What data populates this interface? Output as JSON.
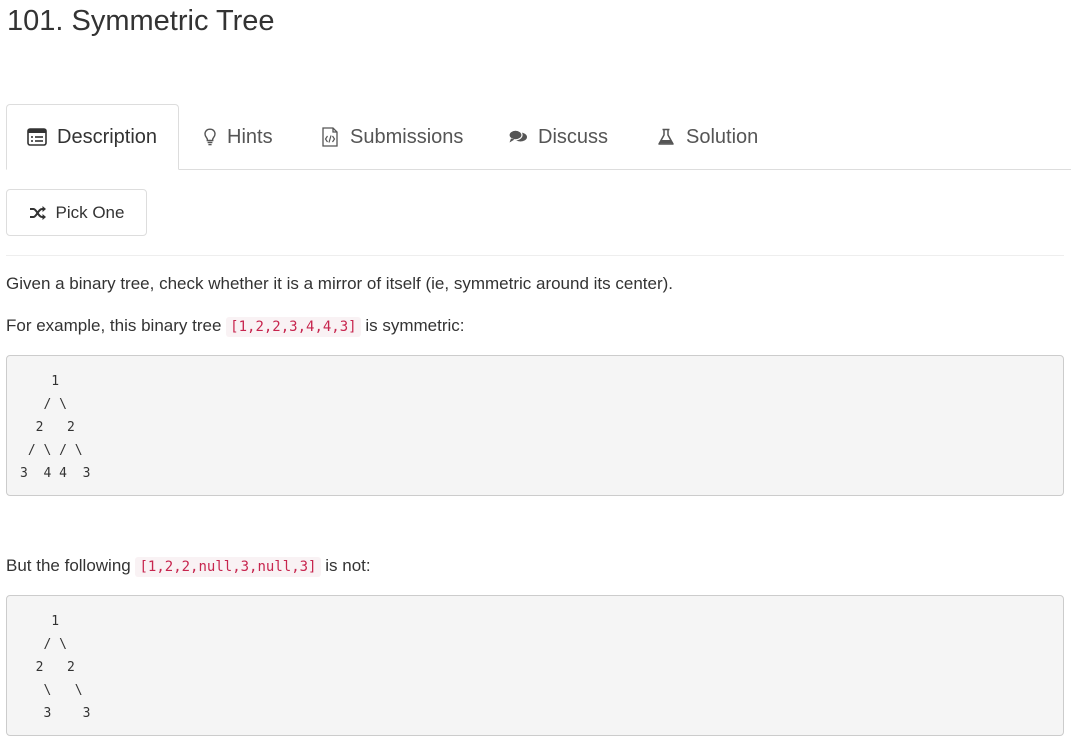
{
  "problem": {
    "title": "101. Symmetric Tree"
  },
  "tabs": [
    {
      "label": "Description",
      "icon": "list-icon",
      "active": true
    },
    {
      "label": "Hints",
      "icon": "lightbulb-icon",
      "active": false
    },
    {
      "label": "Submissions",
      "icon": "code-file-icon",
      "active": false
    },
    {
      "label": "Discuss",
      "icon": "comments-icon",
      "active": false
    },
    {
      "label": "Solution",
      "icon": "flask-icon",
      "active": false
    }
  ],
  "toolbar": {
    "pick_one_label": "Pick One",
    "pick_one_icon": "shuffle-icon"
  },
  "description": {
    "intro": "Given a binary tree, check whether it is a mirror of itself (ie, symmetric around its center).",
    "example1_prefix": "For example, this binary tree",
    "example1_code": "[1,2,2,3,4,4,3]",
    "example1_suffix": "is symmetric:",
    "tree1": "    1\n   / \\\n  2   2\n / \\ / \\\n3  4 4  3",
    "example2_prefix": "But the following",
    "example2_code": "[1,2,2,null,3,null,3]",
    "example2_suffix": "is not:",
    "tree2": "    1\n   / \\\n  2   2\n   \\   \\\n   3    3"
  },
  "colors": {
    "text": "#333333",
    "tab_text": "#555555",
    "inline_code": "#c7254e",
    "inline_code_bg": "#f9f2f4",
    "pre_bg": "#f5f5f5",
    "border": "#dddddd"
  }
}
